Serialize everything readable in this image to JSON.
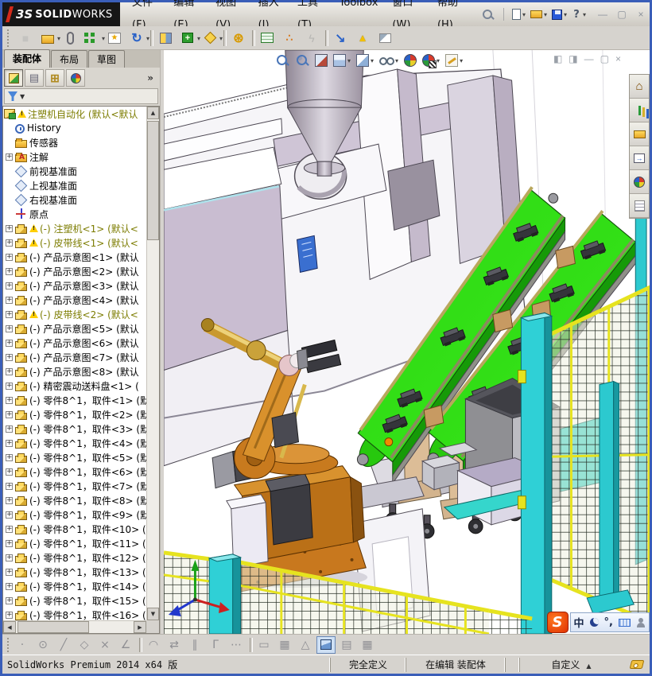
{
  "brand": {
    "mark": "3S",
    "solid": "SOLID",
    "works": "WORKS"
  },
  "menus": [
    {
      "name": "menu-file",
      "label": "文件(F)"
    },
    {
      "name": "menu-edit",
      "label": "编辑(E)"
    },
    {
      "name": "menu-view",
      "label": "视图(V)"
    },
    {
      "name": "menu-insert",
      "label": "插入(I)"
    },
    {
      "name": "menu-tools",
      "label": "工具(T)"
    },
    {
      "name": "menu-toolbox",
      "label": "Toolbox"
    },
    {
      "name": "menu-window",
      "label": "窗口(W)"
    },
    {
      "name": "menu-help",
      "label": "帮助(H)"
    }
  ],
  "quick_toolbar": [
    {
      "name": "new-document",
      "dropdown": true
    },
    {
      "name": "open-document",
      "dropdown": true
    },
    {
      "name": "save-document",
      "dropdown": true
    },
    {
      "name": "help",
      "dropdown": true
    }
  ],
  "window_controls": [
    {
      "name": "minimize",
      "glyph": "—"
    },
    {
      "name": "maximize",
      "glyph": "▢"
    },
    {
      "name": "close",
      "glyph": "×"
    }
  ],
  "main_toolbar": [
    {
      "name": "insert-component",
      "grayed": true
    },
    {
      "name": "insert-components",
      "dropdown": true
    },
    {
      "name": "mate"
    },
    {
      "name": "component-pattern",
      "dropdown": true
    },
    {
      "name": "smart-fasteners"
    },
    {
      "name": "move-component",
      "dropdown": true
    },
    {
      "name": "show-hidden",
      "sep": true
    },
    {
      "name": "assembly-features",
      "dropdown": true
    },
    {
      "name": "reference-geometry",
      "dropdown": true
    },
    {
      "name": "motion-study",
      "sep": true
    },
    {
      "name": "bom",
      "sep": true
    },
    {
      "name": "exploded-view"
    },
    {
      "name": "explode-sketch",
      "grayed": true
    },
    {
      "name": "instant3d",
      "sep": true
    },
    {
      "name": "large-assembly"
    },
    {
      "name": "preview-window"
    }
  ],
  "left_panel": {
    "tabs": [
      {
        "name": "tab-assembly",
        "label": "装配体",
        "active": true
      },
      {
        "name": "tab-layout",
        "label": "布局"
      },
      {
        "name": "tab-sketch",
        "label": "草图"
      }
    ],
    "panel_toolbar": [
      {
        "name": "feature-manager",
        "active": true
      },
      {
        "name": "property-manager"
      },
      {
        "name": "configuration-manager"
      },
      {
        "name": "display-manager"
      }
    ],
    "chevron": "»",
    "tree": {
      "items": [
        {
          "icon": "assembly",
          "label": "注塑机自动化 (默认<默认",
          "warn": true,
          "root": true
        },
        {
          "icon": "history",
          "label": "History"
        },
        {
          "icon": "folder",
          "label": "传感器"
        },
        {
          "icon": "note",
          "label": "注解",
          "expand": true
        },
        {
          "icon": "plane",
          "label": "前视基准面"
        },
        {
          "icon": "plane",
          "label": "上视基准面"
        },
        {
          "icon": "plane",
          "label": "右视基准面"
        },
        {
          "icon": "origin",
          "label": "原点"
        },
        {
          "icon": "part",
          "label": "(-) 注塑机<1> (默认<",
          "warn": true,
          "expand": true
        },
        {
          "icon": "part",
          "label": "(-) 皮带线<1> (默认<",
          "warn": true,
          "expand": true
        },
        {
          "icon": "part",
          "label": "(-) 产品示意图<1> (默认",
          "expand": true
        },
        {
          "icon": "part",
          "label": "(-) 产品示意图<2> (默认",
          "expand": true
        },
        {
          "icon": "part",
          "label": "(-) 产品示意图<3> (默认",
          "expand": true
        },
        {
          "icon": "part",
          "label": "(-) 产品示意图<4> (默认",
          "expand": true
        },
        {
          "icon": "part",
          "label": "(-) 皮带线<2> (默认<",
          "warn": true,
          "expand": true
        },
        {
          "icon": "part",
          "label": "(-) 产品示意图<5> (默认",
          "expand": true
        },
        {
          "icon": "part",
          "label": "(-) 产品示意图<6> (默认",
          "expand": true
        },
        {
          "icon": "part",
          "label": "(-) 产品示意图<7> (默认",
          "expand": true
        },
        {
          "icon": "part",
          "label": "(-) 产品示意图<8> (默认",
          "expand": true
        },
        {
          "icon": "part",
          "label": "(-) 精密震动送料盘<1> (",
          "expand": true
        },
        {
          "icon": "part",
          "label": "(-) 零件8^1，取件<1> (默",
          "expand": true
        },
        {
          "icon": "part",
          "label": "(-) 零件8^1，取件<2> (默",
          "expand": true
        },
        {
          "icon": "part",
          "label": "(-) 零件8^1，取件<3> (默",
          "expand": true
        },
        {
          "icon": "part",
          "label": "(-) 零件8^1，取件<4> (默",
          "expand": true
        },
        {
          "icon": "part",
          "label": "(-) 零件8^1，取件<5> (默",
          "expand": true
        },
        {
          "icon": "part",
          "label": "(-) 零件8^1，取件<6> (默",
          "expand": true
        },
        {
          "icon": "part",
          "label": "(-) 零件8^1，取件<7> (默",
          "expand": true
        },
        {
          "icon": "part",
          "label": "(-) 零件8^1，取件<8> (默",
          "expand": true
        },
        {
          "icon": "part",
          "label": "(-) 零件8^1，取件<9> (默",
          "expand": true
        },
        {
          "icon": "part",
          "label": "(-) 零件8^1，取件<10> (",
          "expand": true
        },
        {
          "icon": "part",
          "label": "(-) 零件8^1，取件<11> (",
          "expand": true
        },
        {
          "icon": "part",
          "label": "(-) 零件8^1，取件<12> (",
          "expand": true
        },
        {
          "icon": "part",
          "label": "(-) 零件8^1，取件<13> (",
          "expand": true
        },
        {
          "icon": "part",
          "label": "(-) 零件8^1，取件<14> (",
          "expand": true
        },
        {
          "icon": "part",
          "label": "(-) 零件8^1，取件<15> (",
          "expand": true
        },
        {
          "icon": "part",
          "label": "(-) 零件8^1，取件<16> (",
          "expand": true
        }
      ]
    }
  },
  "viewport": {
    "heads_up": [
      {
        "name": "zoom-fit"
      },
      {
        "name": "zoom-area"
      },
      {
        "name": "section-view"
      },
      {
        "name": "view-orientation",
        "dropdown": true
      },
      {
        "name": "display-style",
        "dropdown": true
      },
      {
        "name": "hide-show",
        "dropdown": true
      },
      {
        "name": "appearance"
      },
      {
        "name": "scene",
        "dropdown": true
      },
      {
        "name": "edit-appearance",
        "dropdown": true
      }
    ],
    "doc_controls": [
      {
        "name": "pane-left",
        "glyph": "◧"
      },
      {
        "name": "pane-right",
        "glyph": "◨"
      },
      {
        "name": "doc-minimize",
        "glyph": "—"
      },
      {
        "name": "doc-restore",
        "glyph": "▢"
      },
      {
        "name": "doc-close",
        "glyph": "×"
      }
    ],
    "task_pane": [
      {
        "name": "home"
      },
      {
        "name": "resources"
      },
      {
        "name": "design-library"
      },
      {
        "name": "file-explorer"
      },
      {
        "name": "appearances"
      },
      {
        "name": "custom-properties"
      }
    ],
    "language_bar": {
      "logo": "S",
      "items": [
        {
          "name": "chinese-mode",
          "text": "中"
        },
        {
          "name": "moon"
        },
        {
          "name": "punctuation",
          "text": "°,"
        },
        {
          "name": "keyboard"
        },
        {
          "name": "user"
        }
      ]
    }
  },
  "bottom_toolbar": [
    {
      "name": "drag-handle",
      "glyph": ""
    },
    {
      "name": "point",
      "glyph": "·"
    },
    {
      "name": "circle",
      "glyph": "⊙"
    },
    {
      "name": "line",
      "glyph": "╱"
    },
    {
      "name": "polygon",
      "glyph": "◇"
    },
    {
      "name": "trim",
      "glyph": "×"
    },
    {
      "name": "angle",
      "glyph": "∠"
    },
    {
      "name": "tangent",
      "glyph": "◠",
      "sep": true
    },
    {
      "name": "reverse",
      "glyph": "⇄"
    },
    {
      "name": "parallel",
      "glyph": "∥"
    },
    {
      "name": "perpendicular",
      "glyph": "Γ"
    },
    {
      "name": "dotted",
      "glyph": "⋯"
    },
    {
      "name": "ruler",
      "glyph": "▭",
      "sep": true
    },
    {
      "name": "grid",
      "glyph": "▦"
    },
    {
      "name": "triangle",
      "glyph": "△"
    },
    {
      "name": "shaded-cube",
      "glyph": "",
      "active": true
    },
    {
      "name": "two-view",
      "glyph": "▤"
    },
    {
      "name": "four-view",
      "glyph": "▦"
    }
  ],
  "status_bar": {
    "product": "SolidWorks Premium 2014 x64 版",
    "defined": "完全定义",
    "editing": "在编辑 装配体",
    "custom": "自定义"
  }
}
